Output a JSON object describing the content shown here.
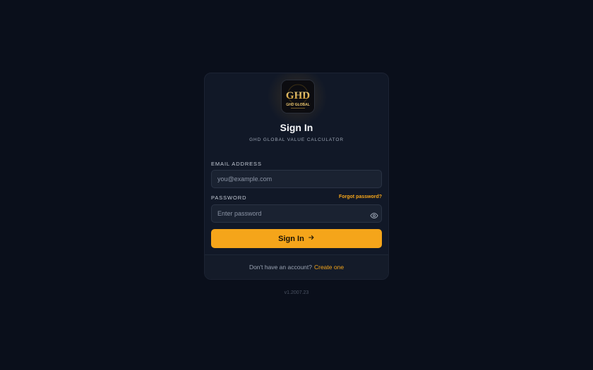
{
  "brand": {
    "logo_text": "GHD",
    "logo_subtext": "GHD GLOBAL"
  },
  "header": {
    "title": "Sign In",
    "subtitle": "GHD GLOBAL VALUE CALCULATOR"
  },
  "form": {
    "email_label": "EMAIL ADDRESS",
    "email_placeholder": "you@example.com",
    "email_value": "",
    "password_label": "PASSWORD",
    "forgot_label": "Forgot password?",
    "password_placeholder": "Enter password",
    "password_value": "",
    "submit_label": "Sign In",
    "toggle_icon": "eye-icon",
    "submit_icon": "arrow-right-icon"
  },
  "footer": {
    "prompt": "Don't have an account?",
    "link": "Create one"
  },
  "version": "v1.2007.23",
  "colors": {
    "accent": "#f5a51a",
    "background": "#0a0f1b",
    "card": "#111827"
  }
}
